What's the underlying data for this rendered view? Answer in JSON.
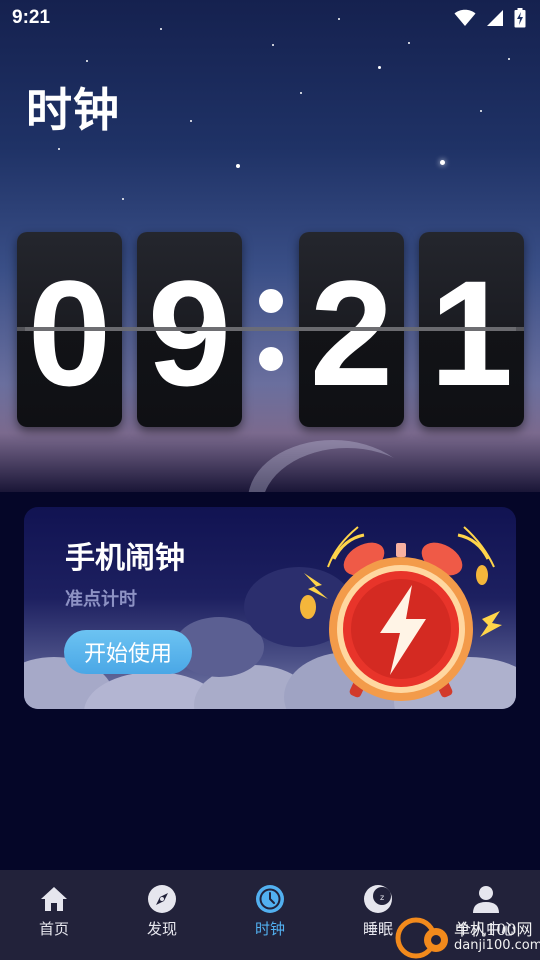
{
  "status_bar": {
    "time": "9:21",
    "icons": [
      "wifi-icon",
      "signal-icon",
      "battery-charging-icon"
    ]
  },
  "page": {
    "title": "时钟"
  },
  "clock": {
    "digits": [
      "0",
      "9",
      "2",
      "1"
    ]
  },
  "banner": {
    "title": "手机闹钟",
    "subtitle": "准点计时",
    "button_label": "开始使用",
    "icon": "alarm-clock-lightning-icon"
  },
  "nav": {
    "items": [
      {
        "label": "首页",
        "icon": "home-icon"
      },
      {
        "label": "发现",
        "icon": "compass-icon"
      },
      {
        "label": "时钟",
        "icon": "clock-icon"
      },
      {
        "label": "睡眠",
        "icon": "moon-sleep-icon"
      },
      {
        "label": "个人中心",
        "icon": "person-icon"
      }
    ],
    "active_index": 2
  },
  "watermark": {
    "line1": "单机100网",
    "line2": "danji100.com"
  },
  "colors": {
    "accent": "#52b0f0",
    "button": "#5ab6ec",
    "nav_bg": "#22223a",
    "background": "#05062a"
  }
}
